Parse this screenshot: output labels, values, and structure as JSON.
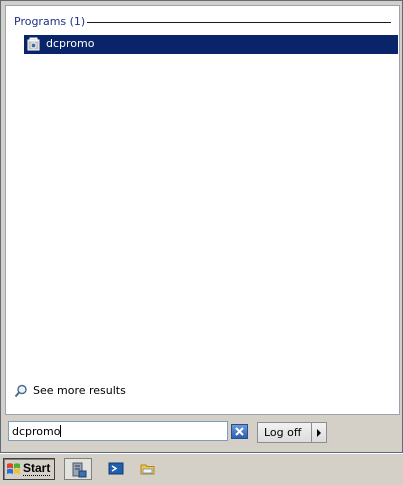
{
  "results": {
    "group_title": "Programs (1)",
    "items": [
      {
        "label": "dcpromo",
        "icon": "program-setup-icon"
      }
    ],
    "see_more_label": "See more results"
  },
  "search": {
    "value": "dcpromo",
    "clear_icon": "clear-search-icon"
  },
  "power": {
    "logoff_label": "Log off",
    "arrow_icon": "chevron-right-icon"
  },
  "taskbar": {
    "start_label": "Start",
    "quick_launch": [
      {
        "name": "server-manager-icon"
      },
      {
        "name": "powershell-icon"
      },
      {
        "name": "windows-explorer-icon"
      }
    ]
  },
  "colors": {
    "selection": "#0a246a",
    "group_title": "#1e3287",
    "menu_bg": "#d4d0c8"
  }
}
